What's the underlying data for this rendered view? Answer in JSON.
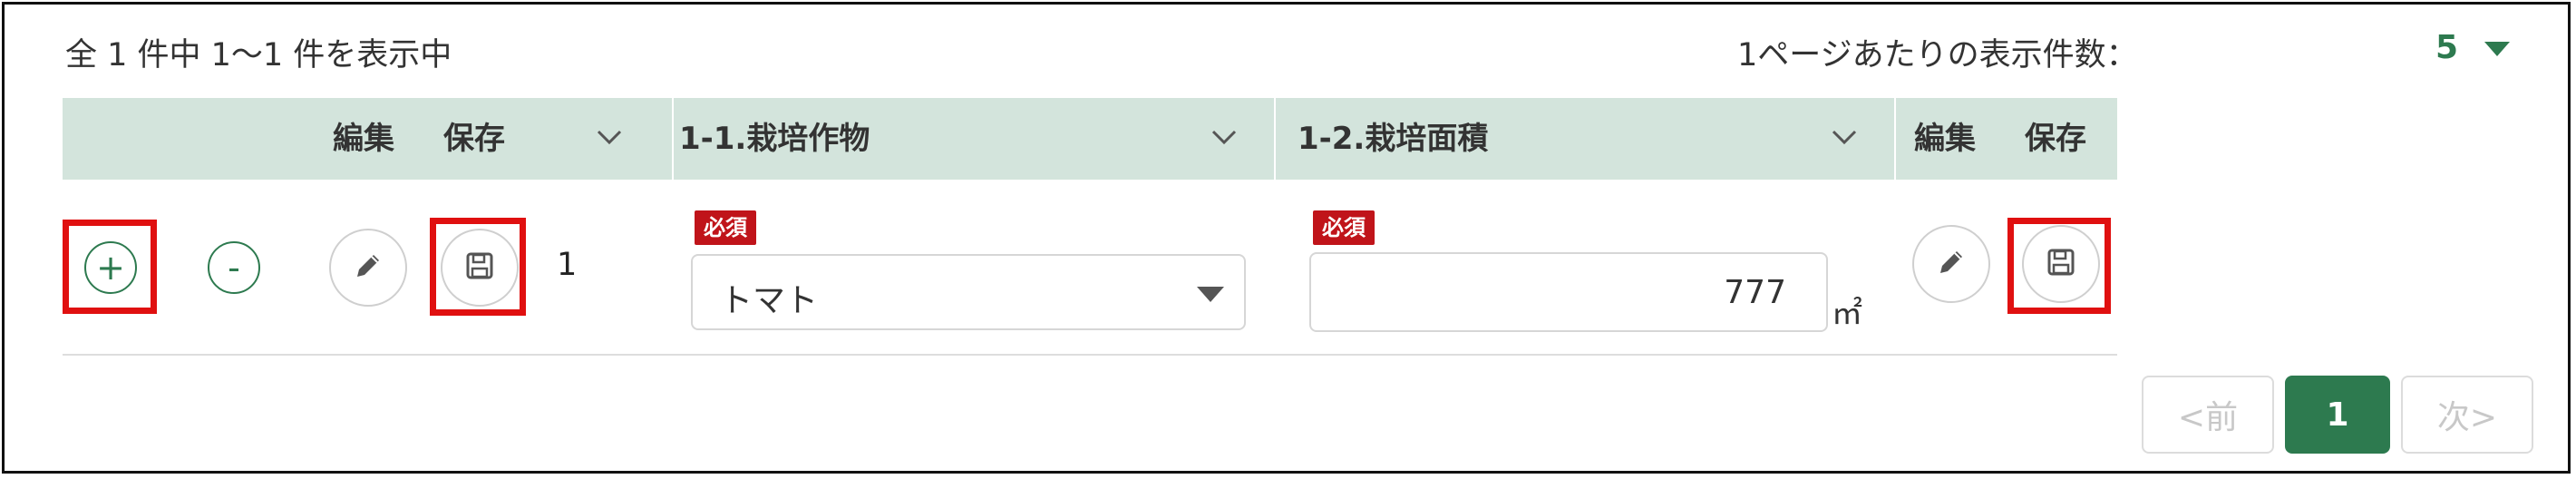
{
  "summary": "全 1 件中 1～1 件を表示中",
  "per_page": {
    "label": "1ページあたりの表示件数：",
    "value": "5"
  },
  "table": {
    "headers": {
      "edit": "編集",
      "save": "保存",
      "crop": "1-1.栽培作物",
      "area": "1-2.栽培面積",
      "edit_right": "編集",
      "save_right": "保存"
    },
    "rows": [
      {
        "add_label": "+",
        "remove_label": "-",
        "number": "1",
        "crop_required": "必須",
        "crop_value": "トマト",
        "area_required": "必須",
        "area_value": "777",
        "area_unit": "㎡"
      }
    ]
  },
  "pagination": {
    "prev": "<前",
    "current": "1",
    "next": "次>"
  },
  "colors": {
    "accent": "#2d7a4f",
    "header_bg": "#d3e4dc",
    "required_badge": "#c0141a",
    "highlight_box": "#e01010"
  },
  "icons": {
    "edit": "pencil-icon",
    "save": "floppy-disk-icon",
    "sort": "chevron-down-icon"
  }
}
